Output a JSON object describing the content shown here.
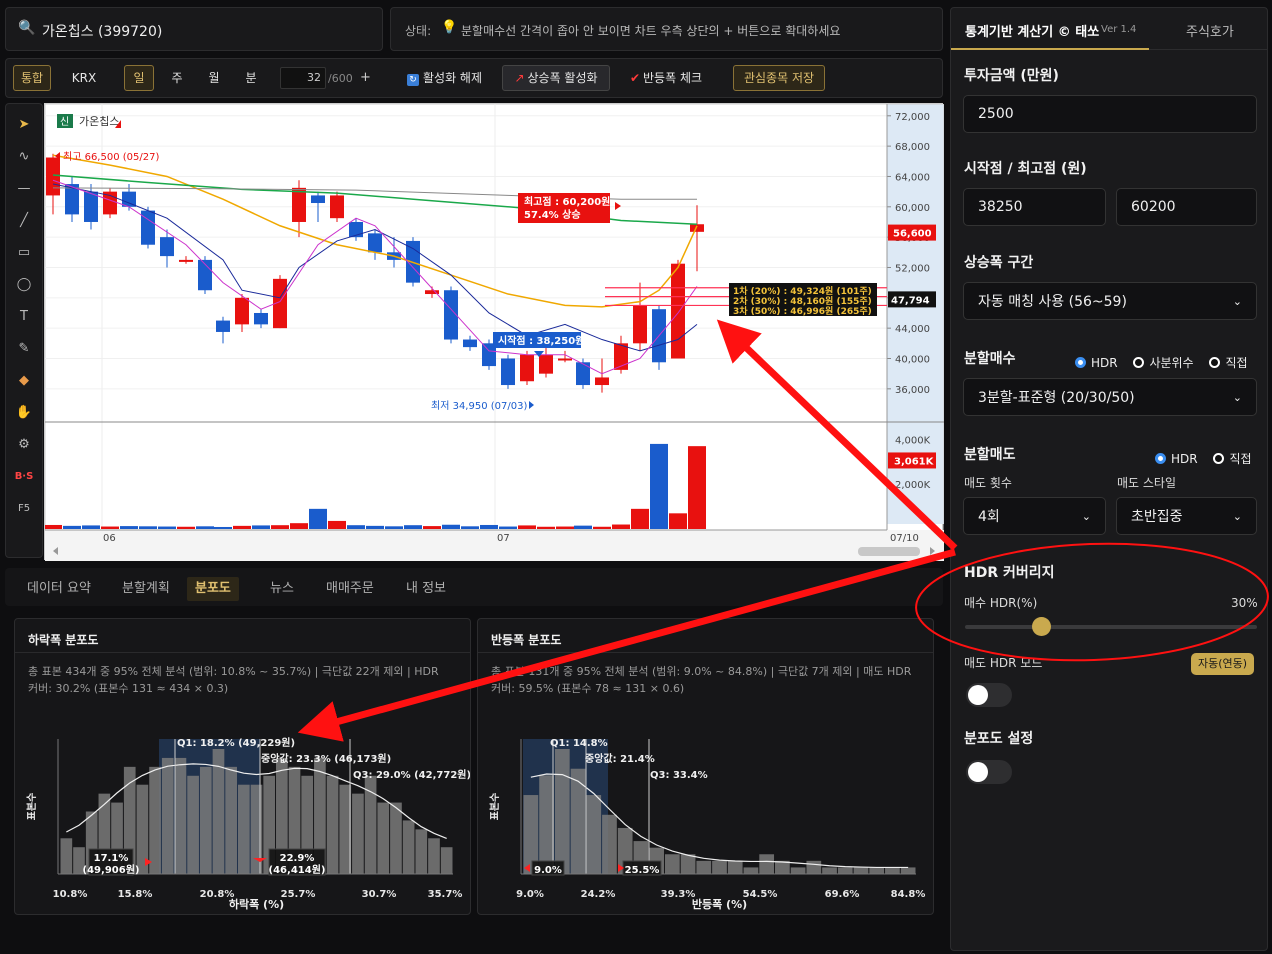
{
  "header": {
    "stock": "가온칩스 (399720)",
    "status_label": "상태:",
    "status_text": "분할매수선 간격이 좁아 안 보이면 차트 우측 상단의 + 버튼으로 확대하세요"
  },
  "toolbar": {
    "integrated": "통합",
    "krx": "KRX",
    "day": "일",
    "week": "주",
    "month": "월",
    "minute": "분",
    "count_value": "32",
    "count_max": "/600",
    "plus": "+",
    "deactivate": "활성화 해제",
    "rise_activate": "상승폭 활성화",
    "rebound_check": "반등폭 체크",
    "save_watch": "관심종목 저장"
  },
  "left_tools": [
    "arrow-icon",
    "trend-icon",
    "hline-icon",
    "line-icon",
    "rect-icon",
    "ellipse-icon",
    "text-icon",
    "brush-icon",
    "eraser-icon",
    "hand-icon",
    "gear-icon",
    "bs-icon",
    "f5-icon"
  ],
  "left_tool_glyphs": [
    "➤",
    "∿",
    "—",
    "╱",
    "▭",
    "◯",
    "T",
    "✎",
    "◆",
    "✋",
    "⚙",
    "B·S",
    "F5"
  ],
  "chart": {
    "badge": "신",
    "name": "가온칩스",
    "high_note": "최고 66,500 (05/27)",
    "low_note": "최저 34,950 (07/03)",
    "peak_box_1": "최고점 : 60,200원",
    "peak_box_2": "57.4% 상승",
    "start_box": "시작점 : 38,250원",
    "buy_lines": [
      "1차 (20%) : 49,324원 (101주)",
      "2차 (30%) : 48,160원 (155주)",
      "3차 (50%) : 46,996원 (265주)"
    ],
    "price_ticks": [
      "72,000",
      "68,000",
      "64,000",
      "60,000",
      "56,000",
      "52,000",
      "48,000",
      "44,000",
      "40,000",
      "36,000"
    ],
    "current_price": "56,600",
    "avg_price": "47,794",
    "volume_ticks": [
      "4,000K",
      "2,000K"
    ],
    "volume_current": "3,061K",
    "x_labels": [
      "06",
      "07",
      "07/10"
    ]
  },
  "bottom_tabs": [
    "데이터 요약",
    "분할계획",
    "분포도",
    "뉴스",
    "매매주문",
    "내 정보"
  ],
  "active_tab_index": 2,
  "drop_dist": {
    "title": "하락폭 분포도",
    "desc_line1": "총 표본 434개 중 95% 전체 분석 (범위: 10.8% ~ 35.7%) | 극단값 22개 제외 | HDR",
    "desc_line2": "커버: 30.2% (표본수 131 ≈ 434 × 0.3)",
    "ylabel": "표본수",
    "xlabel": "하락폭 (%)",
    "x_ticks": [
      "10.8%",
      "15.8%",
      "20.8%",
      "25.7%",
      "30.7%",
      "35.7%"
    ],
    "q1": "Q1: 18.2% (49,229원)",
    "median": "중앙값: 23.3% (46,173원)",
    "q3": "Q3: 29.0% (42,772원)",
    "hdr_left_1": "17.1%",
    "hdr_left_2": "(49,906원)",
    "hdr_right_1": "22.9%",
    "hdr_right_2": "(46,414원)"
  },
  "rebound_dist": {
    "title": "반등폭 분포도",
    "desc_line1": "총 표본 131개 중 95% 전체 분석 (범위: 9.0% ~ 84.8%) | 극단값 7개 제외 | 매도 HDR",
    "desc_line2": "커버: 59.5% (표본수 78 ≈ 131 × 0.6)",
    "ylabel": "표본수",
    "xlabel": "반등폭 (%)",
    "x_ticks": [
      "9.0%",
      "24.2%",
      "39.3%",
      "54.5%",
      "69.6%",
      "84.8%"
    ],
    "q1": "Q1: 14.8%",
    "median": "중앙값: 21.4%",
    "q3": "Q3: 33.4%",
    "hdr_left": "9.0%",
    "hdr_right": "25.5%"
  },
  "chart_data": [
    {
      "type": "bar",
      "title": "하락폭 분포도",
      "xlabel": "하락폭 (%)",
      "ylabel": "표본수",
      "xlim": [
        10.8,
        35.7
      ],
      "values": [
        4,
        3,
        7,
        9,
        8,
        12,
        10,
        12,
        13,
        13,
        11,
        12,
        14,
        12,
        10,
        10,
        11,
        13,
        12,
        11,
        13,
        11,
        10,
        9,
        11,
        8,
        8,
        6,
        5,
        4,
        3
      ]
    },
    {
      "type": "bar",
      "title": "반등폭 분포도",
      "xlabel": "반등폭 (%)",
      "ylabel": "표본수",
      "xlim": [
        9.0,
        84.8
      ],
      "values": [
        12,
        15,
        19,
        16,
        12,
        9,
        7,
        5,
        4,
        3,
        3,
        2,
        2,
        2,
        1,
        3,
        2,
        1,
        2,
        1,
        1,
        1,
        1,
        1,
        1
      ]
    }
  ],
  "right_panel": {
    "title": "통계기반 계산기 © 태쏘",
    "version": "Ver 1.4",
    "tab2": "주식호가",
    "invest_label": "투자금액 (만원)",
    "invest_value": "2500",
    "start_high_label": "시작점 / 최고점 (원)",
    "start_value": "38250",
    "high_value": "60200",
    "range_label": "상승폭 구간",
    "range_value": "자동 매칭 사용 (56~59)",
    "split_buy_label": "분할매수",
    "split_buy_opts": [
      "HDR",
      "사분위수",
      "직접"
    ],
    "split_buy_value": "3분할-표준형 (20/30/50)",
    "split_sell_label": "분할매도",
    "split_sell_opts": [
      "HDR",
      "직접"
    ],
    "sell_count_label": "매도 횟수",
    "sell_count_value": "4회",
    "sell_style_label": "매도 스타일",
    "sell_style_value": "초반집중",
    "hdr_cov_label": "HDR 커버리지",
    "buy_hdr_label": "매수 HDR(%)",
    "buy_hdr_value": "30%",
    "buy_hdr_fraction": 0.26,
    "sell_hdr_mode_label": "매도 HDR 모드",
    "auto_badge": "자동(연동)",
    "dist_setting_label": "분포도 설정"
  },
  "colors": {
    "up": "#e8110f",
    "down": "#1a5ccc",
    "accent": "#c9a94e",
    "annotation": "#ff1111"
  }
}
